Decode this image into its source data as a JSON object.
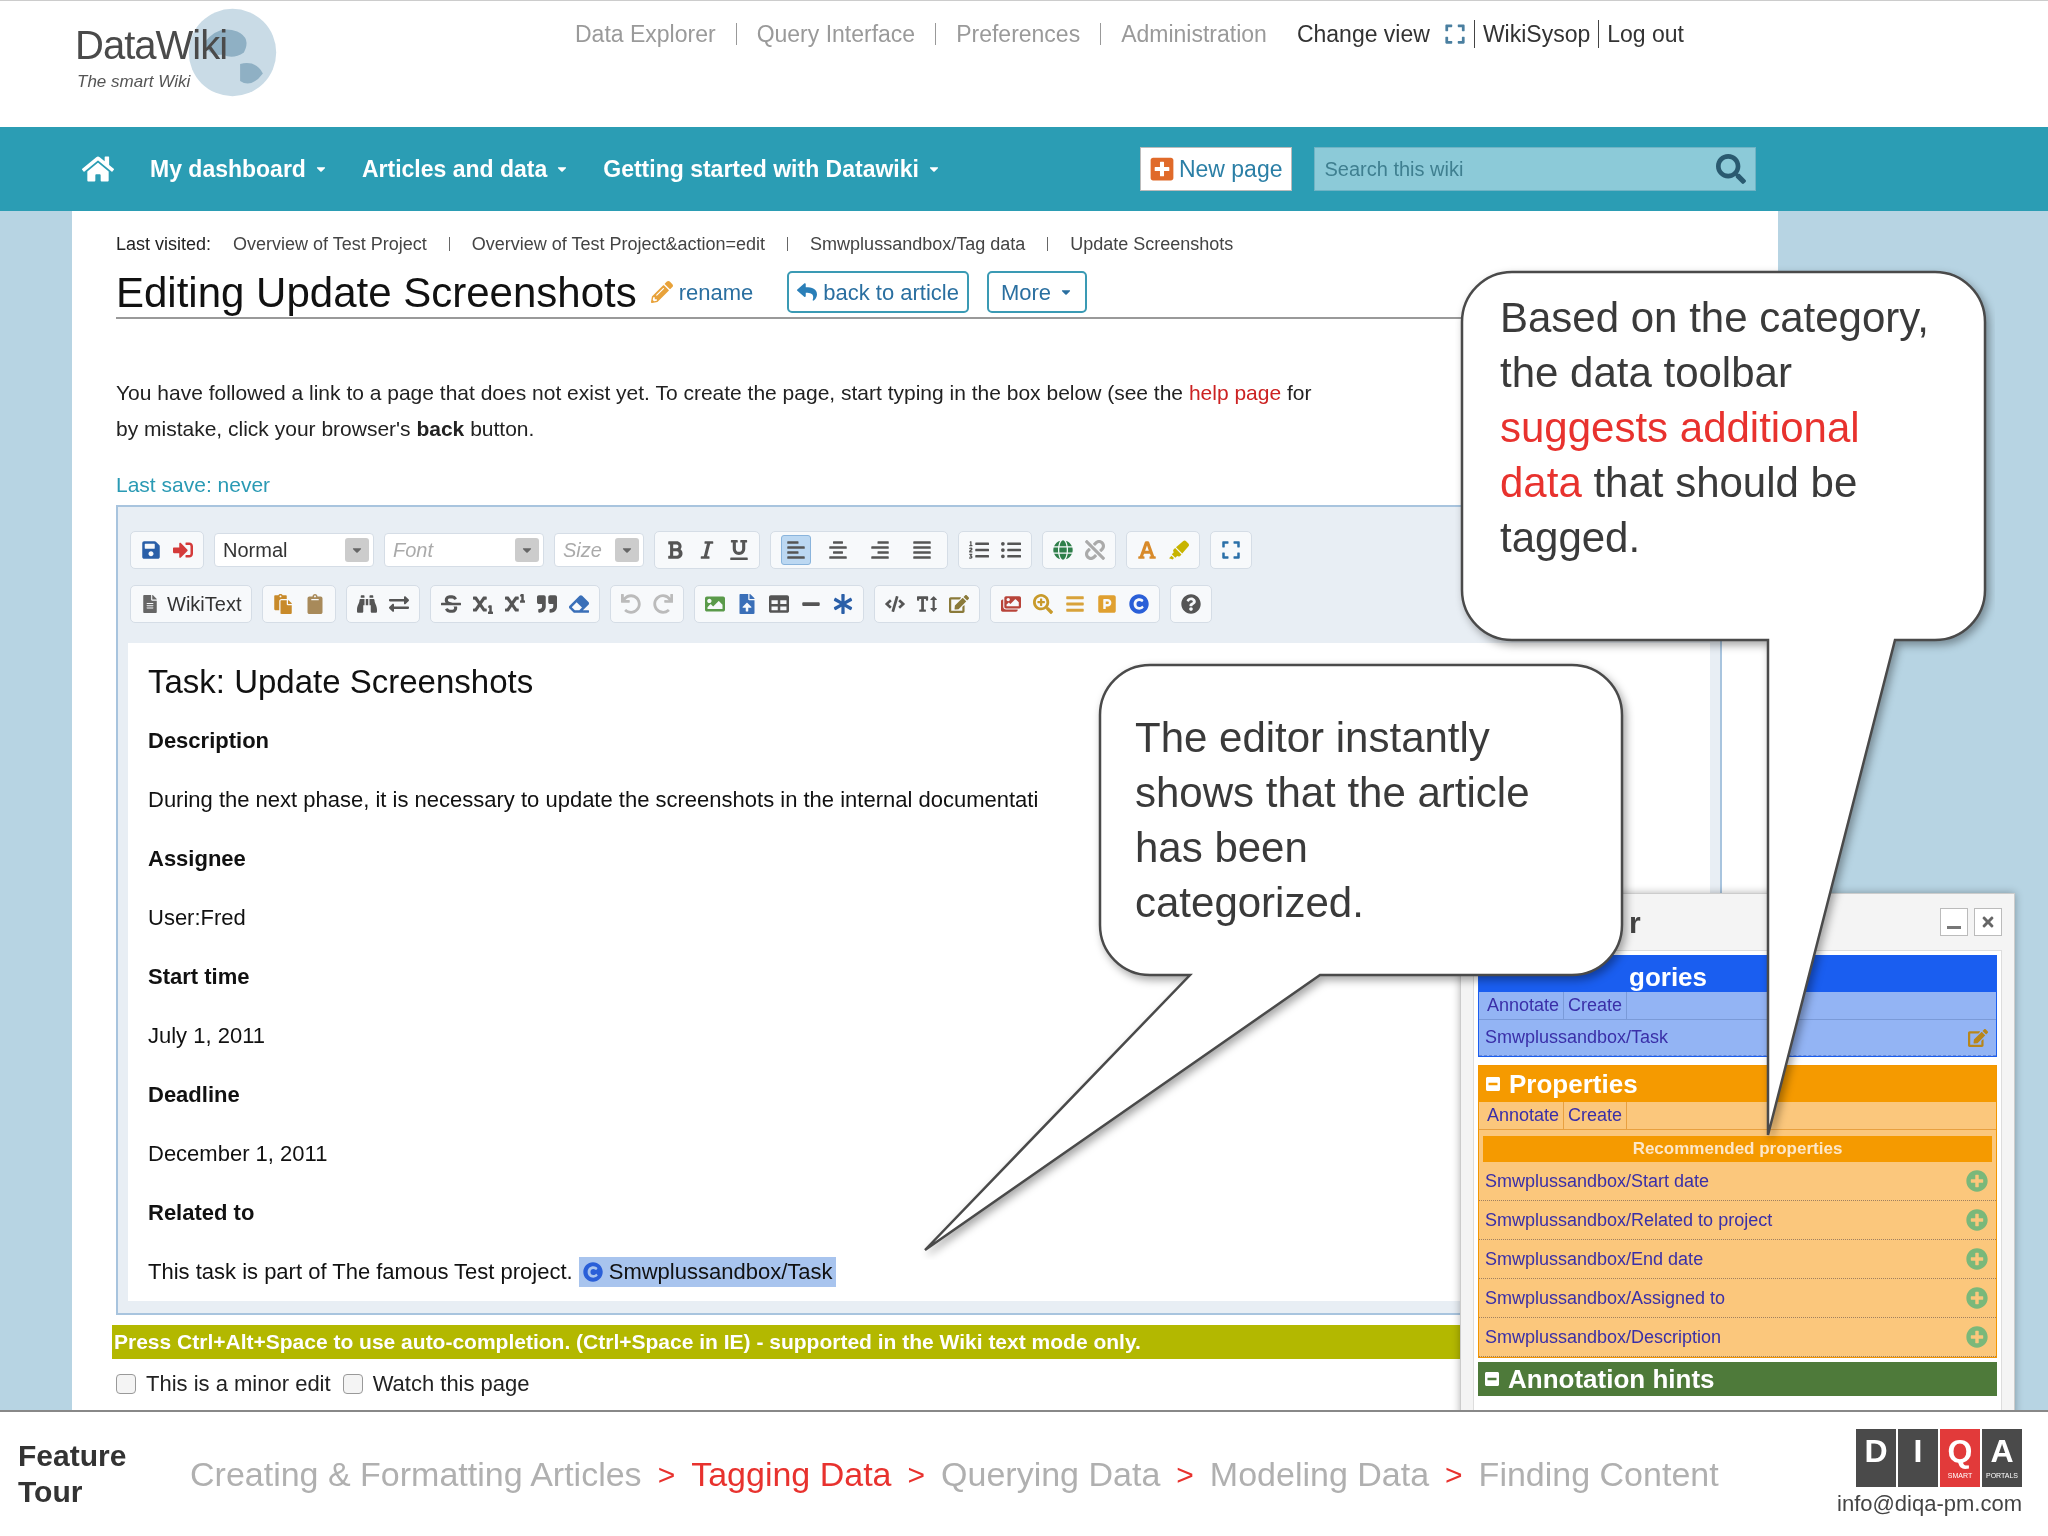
{
  "header": {
    "logo": {
      "name": "DataWiki",
      "tagline": "The smart Wiki"
    },
    "links": [
      {
        "label": "Data Explorer",
        "kind": "admin"
      },
      {
        "label": "Query Interface",
        "kind": "admin"
      },
      {
        "label": "Preferences",
        "kind": "admin"
      },
      {
        "label": "Administration",
        "kind": "admin"
      },
      {
        "label": "Change view",
        "kind": "view"
      },
      {
        "label": "WikiSysop",
        "kind": "user"
      },
      {
        "label": "Log out",
        "kind": "user"
      }
    ]
  },
  "nav": {
    "items": [
      {
        "label": "My dashboard"
      },
      {
        "label": "Articles and data"
      },
      {
        "label": "Getting started with Datawiki"
      }
    ],
    "new_page": "New page",
    "search": {
      "placeholder": "Search this wiki"
    }
  },
  "breadcrumb": {
    "label": "Last visited:",
    "items": [
      "Overview of Test Project",
      "Overview of Test Project&action=edit",
      "Smwplussandbox/Tag data",
      "Update Screenshots"
    ]
  },
  "page": {
    "title": "Editing Update Screenshots",
    "rename": "rename",
    "back": "back to article",
    "more": "More"
  },
  "notice": {
    "before": "You have followed a link to a page that does not exist yet. To create the page, start typing in the box below (see the ",
    "link": "help page",
    "after": " for",
    "line2": "by mistake, click your browser's **back** button."
  },
  "last_save": "Last save: never",
  "toolbar": {
    "format": "Normal",
    "font_placeholder": "Font",
    "size_placeholder": "Size",
    "mode": "WikiText",
    "alignments": [
      {
        "selected": true
      },
      {
        "selected": false
      },
      {
        "selected": false
      },
      {
        "selected": false
      }
    ]
  },
  "editor": {
    "heading": "Task: Update Screenshots",
    "fields": [
      {
        "label": "Description",
        "value": "During the next phase, it is necessary to update the screenshots in the internal documentati"
      },
      {
        "label": "Assignee",
        "value": "User:Fred"
      },
      {
        "label": "Start time",
        "value": "July 1, 2011"
      },
      {
        "label": "Deadline",
        "value": "December 1, 2011"
      },
      {
        "label": "Related to",
        "value": "This task is part of The famous Test project.",
        "annotation": "Smwplussandbox/Task"
      }
    ]
  },
  "hint": "Press Ctrl+Alt+Space to use auto-completion. (Ctrl+Space in IE) - supported in the Wiki text mode only.",
  "options": [
    {
      "label": "This is a minor edit",
      "checked": false
    },
    {
      "label": "Watch this page",
      "checked": false
    }
  ],
  "semantic_toolbar": {
    "title": "r",
    "categories": {
      "header": "gories",
      "actions": [
        "Annotate",
        "Create"
      ],
      "items": [
        "Smwplussandbox/Task"
      ]
    },
    "properties": {
      "header": "Properties",
      "actions": [
        "Annotate",
        "Create"
      ],
      "recommended_label": "Recommended properties",
      "items": [
        "Smwplussandbox/Start date",
        "Smwplussandbox/Related to project",
        "Smwplussandbox/End date",
        "Smwplussandbox/Assigned to",
        "Smwplussandbox/Description"
      ]
    },
    "annotation_hints": {
      "header": "Annotation hints"
    }
  },
  "callouts": [
    {
      "segments": [
        {
          "text": "Based on the category, the data toolbar ",
          "highlight": false
        },
        {
          "text": "suggests additional data",
          "highlight": true
        },
        {
          "text": " that should be tagged.",
          "highlight": false
        }
      ]
    },
    {
      "segments": [
        {
          "text": "The editor instantly shows that the article has been categorized.",
          "highlight": false
        }
      ]
    }
  ],
  "footer": {
    "title": "Feature Tour",
    "separator": ">",
    "steps": [
      {
        "label": "Creating & Formatting Articles",
        "selected": false
      },
      {
        "label": "Tagging Data",
        "selected": true
      },
      {
        "label": "Querying Data",
        "selected": false
      },
      {
        "label": "Modeling Data",
        "selected": false
      },
      {
        "label": "Finding Content",
        "selected": false
      }
    ],
    "logo_letters": [
      "D",
      "I",
      "Q",
      "A"
    ],
    "logo_sub": [
      "SMART",
      "PORTALS"
    ],
    "email": "info@diqa-pm.com"
  }
}
